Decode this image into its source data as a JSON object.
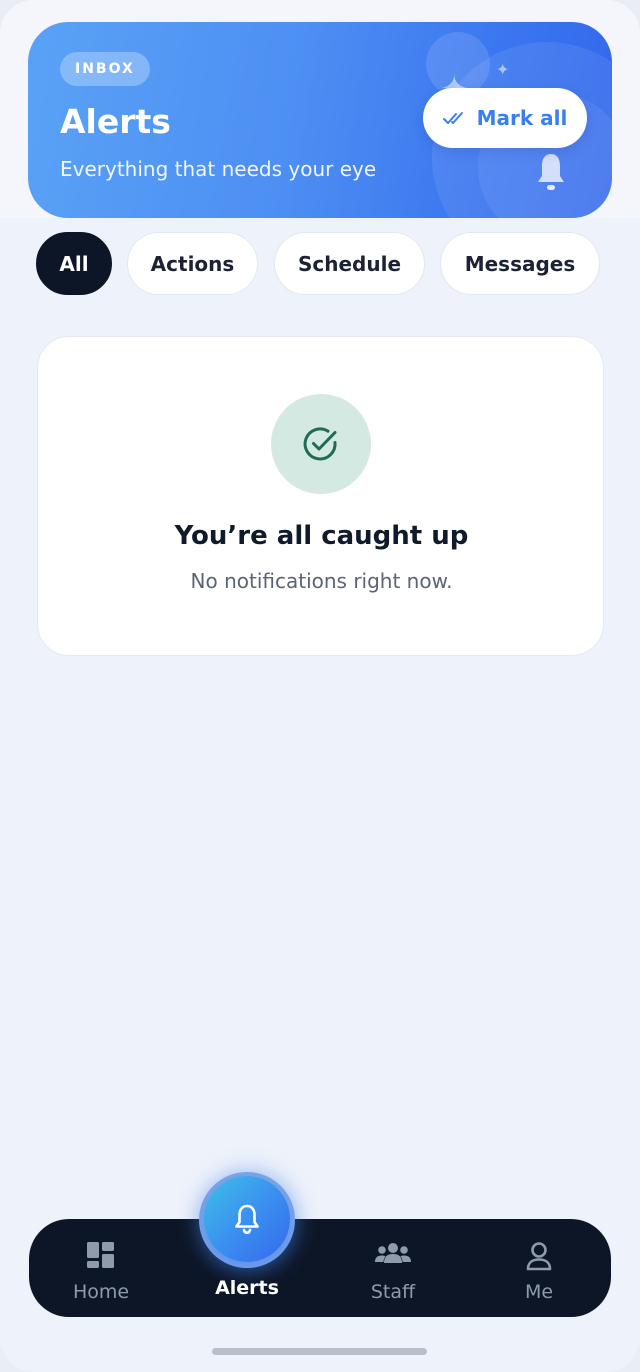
{
  "header": {
    "badge": "INBOX",
    "title": "Alerts",
    "subtitle": "Everything that needs your eye",
    "mark_all_label": "Mark all",
    "mark_all_icon": "double-check-icon",
    "decor_icon": "bell-icon"
  },
  "filters": [
    {
      "label": "All",
      "active": true
    },
    {
      "label": "Actions",
      "active": false
    },
    {
      "label": "Schedule",
      "active": false
    },
    {
      "label": "Messages",
      "active": false
    }
  ],
  "empty_state": {
    "icon": "check-circle-icon",
    "title": "You’re all caught up",
    "message": "No notifications right now."
  },
  "tabbar": {
    "items": [
      {
        "label": "Home",
        "icon": "dashboard-icon",
        "active": false
      },
      {
        "label": "Alerts",
        "icon": "bell-icon",
        "active": true
      },
      {
        "label": "Staff",
        "icon": "group-icon",
        "active": false
      },
      {
        "label": "Me",
        "icon": "person-icon",
        "active": false
      }
    ]
  },
  "colors": {
    "accent": "#3a7ff0",
    "header_gradient_start": "#5aa2f6",
    "header_gradient_end": "#3268ec",
    "nav_background": "#0d1627",
    "success_tint": "#d3e9e1",
    "success_icon": "#1f6b55"
  }
}
